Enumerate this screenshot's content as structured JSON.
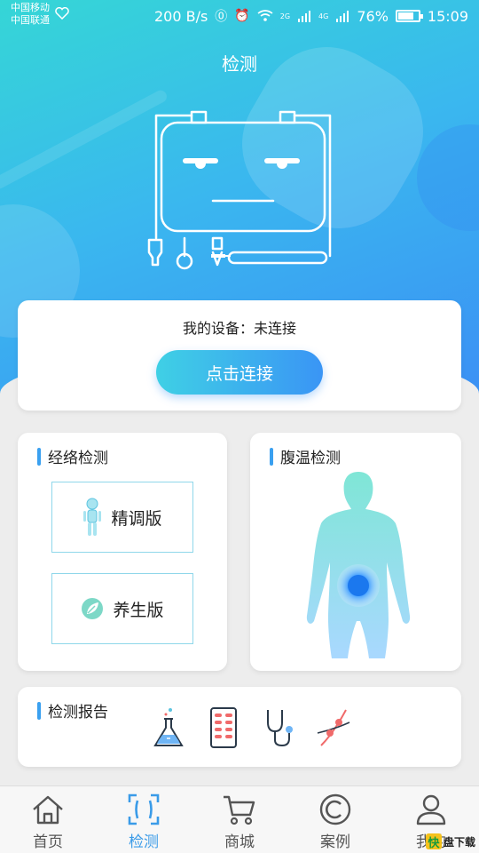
{
  "status_bar": {
    "carrier_1": "中国移动",
    "carrier_2": "中国联通",
    "network_speed": "200 B/s",
    "signal_2g": "2G",
    "signal_4g": "4G",
    "battery": "76%",
    "battery_level": 0.76,
    "time": "15:09"
  },
  "header": {
    "title": "检测"
  },
  "device": {
    "status_text": "我的设备：未连接",
    "connect_label": "点击连接"
  },
  "meridian": {
    "title": "经络检测",
    "options": [
      {
        "label": "精调版",
        "icon": "person-figure-icon"
      },
      {
        "label": "养生版",
        "icon": "leaf-icon"
      }
    ]
  },
  "abdomen": {
    "title": "腹温检测"
  },
  "report": {
    "title": "检测报告",
    "icons": [
      "flask-icon",
      "pill-pack-icon",
      "stethoscope-icon",
      "dna-icon"
    ]
  },
  "tabs": [
    {
      "label": "首页",
      "icon": "home-icon",
      "active": false
    },
    {
      "label": "检测",
      "icon": "scan-icon",
      "active": true
    },
    {
      "label": "商城",
      "icon": "cart-icon",
      "active": false
    },
    {
      "label": "案例",
      "icon": "case-icon",
      "active": false
    },
    {
      "label": "我的",
      "icon": "user-icon",
      "active": false
    }
  ],
  "watermark": {
    "logo": "快",
    "text": "盘下载"
  },
  "colors": {
    "accent": "#3a9be8",
    "hero_start": "#35d6d6",
    "hero_end": "#3b8cf5"
  }
}
